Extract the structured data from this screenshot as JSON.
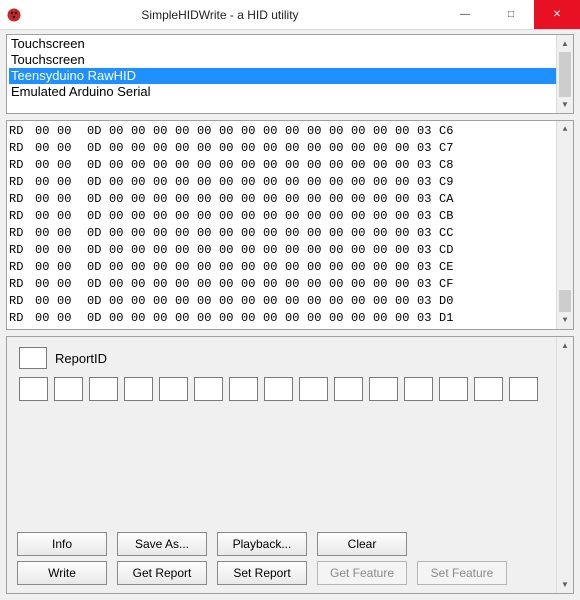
{
  "window": {
    "title": "SimpleHIDWrite - a HID utility",
    "min_glyph": "—",
    "max_glyph": "□",
    "close_glyph": "✕"
  },
  "devices": {
    "items": [
      {
        "label": "Touchscreen",
        "selected": false
      },
      {
        "label": "Touchscreen",
        "selected": false
      },
      {
        "label": "Teensyduino RawHID",
        "selected": true
      },
      {
        "label": "Emulated Arduino Serial",
        "selected": false
      }
    ]
  },
  "log": {
    "rows": [
      [
        "RD",
        "00",
        "00",
        "0D",
        "00",
        "00",
        "00",
        "00",
        "00",
        "00",
        "00",
        "00",
        "00",
        "00",
        "00",
        "00",
        "00",
        "00",
        "03",
        "C6"
      ],
      [
        "RD",
        "00",
        "00",
        "0D",
        "00",
        "00",
        "00",
        "00",
        "00",
        "00",
        "00",
        "00",
        "00",
        "00",
        "00",
        "00",
        "00",
        "00",
        "03",
        "C7"
      ],
      [
        "RD",
        "00",
        "00",
        "0D",
        "00",
        "00",
        "00",
        "00",
        "00",
        "00",
        "00",
        "00",
        "00",
        "00",
        "00",
        "00",
        "00",
        "00",
        "03",
        "C8"
      ],
      [
        "RD",
        "00",
        "00",
        "0D",
        "00",
        "00",
        "00",
        "00",
        "00",
        "00",
        "00",
        "00",
        "00",
        "00",
        "00",
        "00",
        "00",
        "00",
        "03",
        "C9"
      ],
      [
        "RD",
        "00",
        "00",
        "0D",
        "00",
        "00",
        "00",
        "00",
        "00",
        "00",
        "00",
        "00",
        "00",
        "00",
        "00",
        "00",
        "00",
        "00",
        "03",
        "CA"
      ],
      [
        "RD",
        "00",
        "00",
        "0D",
        "00",
        "00",
        "00",
        "00",
        "00",
        "00",
        "00",
        "00",
        "00",
        "00",
        "00",
        "00",
        "00",
        "00",
        "03",
        "CB"
      ],
      [
        "RD",
        "00",
        "00",
        "0D",
        "00",
        "00",
        "00",
        "00",
        "00",
        "00",
        "00",
        "00",
        "00",
        "00",
        "00",
        "00",
        "00",
        "00",
        "03",
        "CC"
      ],
      [
        "RD",
        "00",
        "00",
        "0D",
        "00",
        "00",
        "00",
        "00",
        "00",
        "00",
        "00",
        "00",
        "00",
        "00",
        "00",
        "00",
        "00",
        "00",
        "03",
        "CD"
      ],
      [
        "RD",
        "00",
        "00",
        "0D",
        "00",
        "00",
        "00",
        "00",
        "00",
        "00",
        "00",
        "00",
        "00",
        "00",
        "00",
        "00",
        "00",
        "00",
        "03",
        "CE"
      ],
      [
        "RD",
        "00",
        "00",
        "0D",
        "00",
        "00",
        "00",
        "00",
        "00",
        "00",
        "00",
        "00",
        "00",
        "00",
        "00",
        "00",
        "00",
        "00",
        "03",
        "CF"
      ],
      [
        "RD",
        "00",
        "00",
        "0D",
        "00",
        "00",
        "00",
        "00",
        "00",
        "00",
        "00",
        "00",
        "00",
        "00",
        "00",
        "00",
        "00",
        "00",
        "03",
        "D0"
      ],
      [
        "RD",
        "00",
        "00",
        "0D",
        "00",
        "00",
        "00",
        "00",
        "00",
        "00",
        "00",
        "00",
        "00",
        "00",
        "00",
        "00",
        "00",
        "00",
        "03",
        "D1"
      ]
    ]
  },
  "report": {
    "label": "ReportID",
    "byte_count": 15
  },
  "buttons": {
    "row1": [
      {
        "label": "Info",
        "disabled": false
      },
      {
        "label": "Save As...",
        "disabled": false
      },
      {
        "label": "Playback...",
        "disabled": false
      },
      {
        "label": "Clear",
        "disabled": false
      }
    ],
    "row2": [
      {
        "label": "Write",
        "disabled": false
      },
      {
        "label": "Get Report",
        "disabled": false
      },
      {
        "label": "Set Report",
        "disabled": false
      },
      {
        "label": "Get Feature",
        "disabled": true
      },
      {
        "label": "Set Feature",
        "disabled": true
      }
    ]
  },
  "scroll_glyphs": {
    "up": "▲",
    "down": "▼"
  }
}
